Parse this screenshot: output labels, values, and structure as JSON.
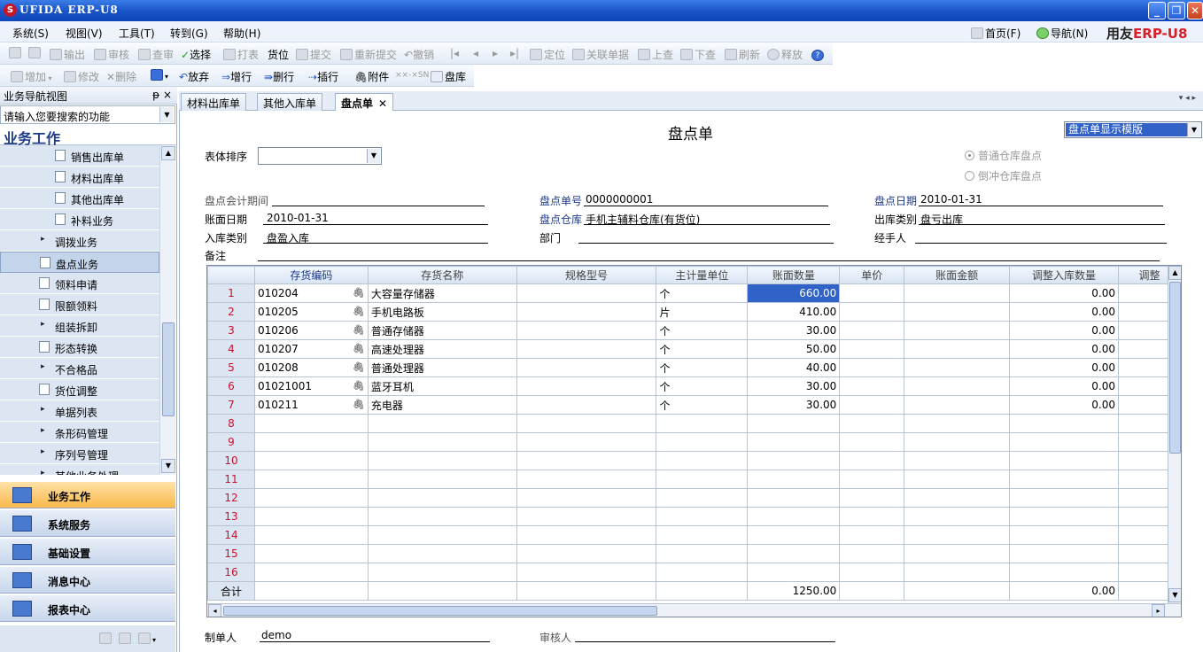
{
  "window": {
    "title": "UFIDA ERP-U8",
    "logo_letter": "S"
  },
  "menu": [
    "系统(S)",
    "视图(V)",
    "工具(T)",
    "转到(G)",
    "帮助(H)"
  ],
  "right_links": {
    "home": "首页(F)",
    "nav": "导航(N)"
  },
  "brand": {
    "a": "用友",
    "b": "ERP-U8"
  },
  "toolbar1": [
    {
      "label": "",
      "on": false
    },
    {
      "label": "输出",
      "on": false
    },
    {
      "label": "审核",
      "on": false
    },
    {
      "label": "查审",
      "on": false
    },
    {
      "label": "选择",
      "on": true
    },
    {
      "label": "打表",
      "on": false
    },
    {
      "label": "货位",
      "on": true
    },
    {
      "label": "提交",
      "on": false
    },
    {
      "label": "重新提交",
      "on": false
    },
    {
      "label": "撤销",
      "on": false
    },
    {
      "label": "定位",
      "on": false
    },
    {
      "label": "关联单据",
      "on": false
    },
    {
      "label": "上查",
      "on": false
    },
    {
      "label": "下查",
      "on": false
    },
    {
      "label": "刷新",
      "on": false
    },
    {
      "label": "释放",
      "on": false
    }
  ],
  "toolbar2": [
    {
      "label": "增加",
      "on": false
    },
    {
      "label": "修改",
      "on": false
    },
    {
      "label": "删除",
      "on": false
    },
    {
      "label": "放弃",
      "on": true
    },
    {
      "label": "增行",
      "on": true
    },
    {
      "label": "删行",
      "on": true
    },
    {
      "label": "插行",
      "on": true
    },
    {
      "label": "附件",
      "on": true
    },
    {
      "label": "SN",
      "on": false
    },
    {
      "label": "盘库",
      "on": true
    }
  ],
  "leftpane": {
    "title": "业务导航视图",
    "pin": "ᵽ ×",
    "search_placeholder": "请输入您要搜索的功能",
    "section": "业务工作",
    "items": [
      {
        "label": "销售出库单",
        "kind": "doc",
        "level": 2
      },
      {
        "label": "材料出库单",
        "kind": "doc",
        "level": 2
      },
      {
        "label": "其他出库单",
        "kind": "doc",
        "level": 2
      },
      {
        "label": "补料业务",
        "kind": "doc",
        "level": 2
      },
      {
        "label": "调拨业务",
        "kind": "folder",
        "level": 1
      },
      {
        "label": "盘点业务",
        "kind": "doc",
        "level": 1
      },
      {
        "label": "领料申请",
        "kind": "doc",
        "level": 1
      },
      {
        "label": "限额领料",
        "kind": "doc",
        "level": 1
      },
      {
        "label": "组装拆卸",
        "kind": "folder",
        "level": 1
      },
      {
        "label": "形态转换",
        "kind": "doc",
        "level": 1
      },
      {
        "label": "不合格品",
        "kind": "folder",
        "level": 1
      },
      {
        "label": "货位调整",
        "kind": "doc",
        "level": 1
      },
      {
        "label": "单据列表",
        "kind": "folder",
        "level": 1
      },
      {
        "label": "条形码管理",
        "kind": "folder",
        "level": 1
      },
      {
        "label": "序列号管理",
        "kind": "folder",
        "level": 1
      },
      {
        "label": "其他业务处理",
        "kind": "folder",
        "level": 1
      }
    ],
    "big_buttons": [
      "业务工作",
      "系统服务",
      "基础设置",
      "消息中心",
      "报表中心"
    ]
  },
  "tabs": [
    {
      "label": "材料出库单",
      "active": false
    },
    {
      "label": "其他入库单",
      "active": false
    },
    {
      "label": "盘点单",
      "active": true
    }
  ],
  "form": {
    "title": "盘点单",
    "template": "盘点单显示模版",
    "sort_label": "表体排序",
    "radio_normal": "普通仓库盘点",
    "radio_reverse": "倒冲仓库盘点",
    "period_label": "盘点会计期间",
    "period_value": "",
    "no_label": "盘点单号",
    "no_value": "0000000001",
    "date_label": "盘点日期",
    "date_value": "2010-01-31",
    "book_date_label": "账面日期",
    "book_date_value": "2010-01-31",
    "warehouse_label": "盘点仓库",
    "warehouse_value": "手机主辅料仓库(有货位)",
    "out_type_label": "出库类别",
    "out_type_value": "盘亏出库",
    "in_type_label": "入库类别",
    "in_type_value": "盘盈入库",
    "dept_label": "部门",
    "dept_value": "",
    "handler_label": "经手人",
    "handler_value": "",
    "note_label": "备注",
    "maker_label": "制单人",
    "maker_value": "demo",
    "auditor_label": "审核人",
    "auditor_value": ""
  },
  "grid": {
    "columns": [
      "存货编码",
      "存货名称",
      "规格型号",
      "主计量单位",
      "账面数量",
      "单价",
      "账面金额",
      "调整入库数量",
      "调整"
    ],
    "rows": [
      {
        "no": "1",
        "code": "010204",
        "name": "大容量存储器",
        "spec": "",
        "unit": "个",
        "qty": "660.00",
        "price": "",
        "amount": "",
        "adj": "0.00"
      },
      {
        "no": "2",
        "code": "010205",
        "name": "手机电路板",
        "spec": "",
        "unit": "片",
        "qty": "410.00",
        "price": "",
        "amount": "",
        "adj": "0.00"
      },
      {
        "no": "3",
        "code": "010206",
        "name": "普通存储器",
        "spec": "",
        "unit": "个",
        "qty": "30.00",
        "price": "",
        "amount": "",
        "adj": "0.00"
      },
      {
        "no": "4",
        "code": "010207",
        "name": "高速处理器",
        "spec": "",
        "unit": "个",
        "qty": "50.00",
        "price": "",
        "amount": "",
        "adj": "0.00"
      },
      {
        "no": "5",
        "code": "010208",
        "name": "普通处理器",
        "spec": "",
        "unit": "个",
        "qty": "40.00",
        "price": "",
        "amount": "",
        "adj": "0.00"
      },
      {
        "no": "6",
        "code": "01021001",
        "name": "蓝牙耳机",
        "spec": "",
        "unit": "个",
        "qty": "30.00",
        "price": "",
        "amount": "",
        "adj": "0.00"
      },
      {
        "no": "7",
        "code": "010211",
        "name": "充电器",
        "spec": "",
        "unit": "个",
        "qty": "30.00",
        "price": "",
        "amount": "",
        "adj": "0.00"
      }
    ],
    "empty_row_numbers": [
      "8",
      "9",
      "10",
      "11",
      "12",
      "13",
      "14",
      "15",
      "16"
    ],
    "total_label": "合计",
    "total_qty": "1250.00",
    "total_adj": "0.00"
  }
}
